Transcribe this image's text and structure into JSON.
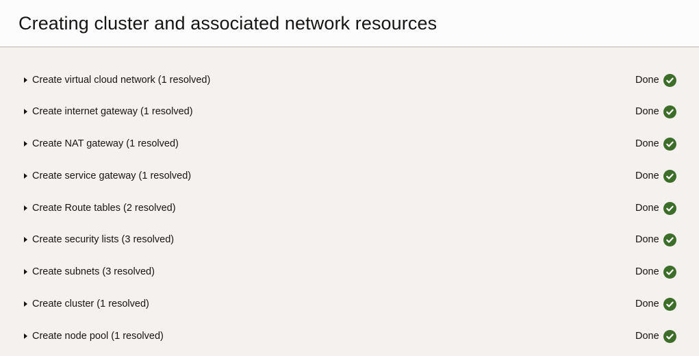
{
  "page": {
    "title": "Creating cluster and associated network resources"
  },
  "colors": {
    "background": "#f4f1ee",
    "header_background": "#fcfcfc",
    "success": "#3c6e2a",
    "text": "#161513"
  },
  "steps": [
    {
      "label": "Create virtual cloud network (1 resolved)",
      "status": "Done",
      "icon": "check-circle-icon"
    },
    {
      "label": "Create internet gateway (1 resolved)",
      "status": "Done",
      "icon": "check-circle-icon"
    },
    {
      "label": "Create NAT gateway (1 resolved)",
      "status": "Done",
      "icon": "check-circle-icon"
    },
    {
      "label": "Create service gateway (1 resolved)",
      "status": "Done",
      "icon": "check-circle-icon"
    },
    {
      "label": "Create Route tables (2 resolved)",
      "status": "Done",
      "icon": "check-circle-icon"
    },
    {
      "label": "Create security lists (3 resolved)",
      "status": "Done",
      "icon": "check-circle-icon"
    },
    {
      "label": "Create subnets (3 resolved)",
      "status": "Done",
      "icon": "check-circle-icon"
    },
    {
      "label": "Create cluster (1 resolved)",
      "status": "Done",
      "icon": "check-circle-icon"
    },
    {
      "label": "Create node pool (1 resolved)",
      "status": "Done",
      "icon": "check-circle-icon"
    }
  ]
}
